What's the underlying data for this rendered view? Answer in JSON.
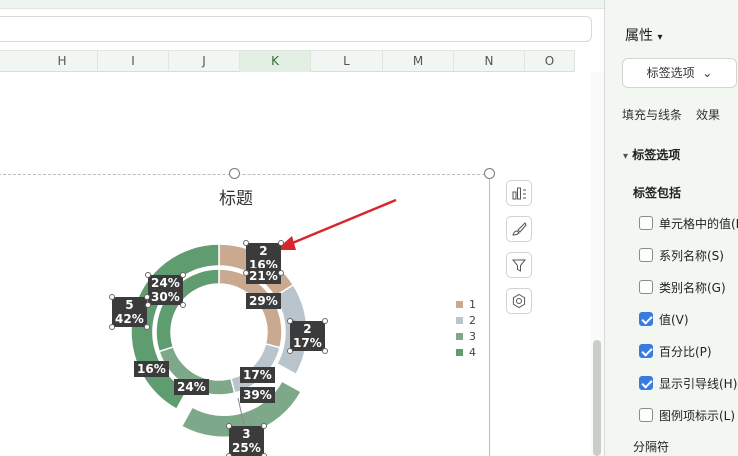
{
  "sheet": {
    "columns": [
      "H",
      "I",
      "J",
      "K",
      "L",
      "M",
      "N",
      "O"
    ],
    "selected_columns": [
      "K"
    ]
  },
  "chart": {
    "title": "标题"
  },
  "chart_data": {
    "type": "pie",
    "subtype": "doughnut",
    "title": "标题",
    "legend_position": "right",
    "series": [
      {
        "name": "1",
        "color": "#c9a990"
      },
      {
        "name": "2",
        "color": "#b9c4cc"
      },
      {
        "name": "3",
        "color": "#7ea88a"
      },
      {
        "name": "4",
        "color": "#5f9c70"
      }
    ],
    "rings": [
      {
        "ring": "inner",
        "slices": [
          {
            "series": "1",
            "percent": 29
          },
          {
            "series": "2",
            "percent": 17
          },
          {
            "series": "3",
            "percent": 24
          },
          {
            "series": "4",
            "percent": 30
          }
        ]
      },
      {
        "ring": "outer",
        "slices": [
          {
            "series": "1",
            "percent": 16
          },
          {
            "series": "2",
            "percent": 17
          },
          {
            "series": "3",
            "percent": 25
          },
          {
            "series": "4",
            "percent": 42
          }
        ]
      }
    ],
    "data_labels": [
      {
        "value": "2",
        "percent": "16%"
      },
      {
        "value": "",
        "percent": "21%"
      },
      {
        "value": "",
        "percent": "29%"
      },
      {
        "value": "2",
        "percent": "17%"
      },
      {
        "value": "",
        "percent": "17%"
      },
      {
        "value": "",
        "percent": "39%"
      },
      {
        "value": "3",
        "percent": "25%"
      },
      {
        "value": "",
        "percent": "24%"
      },
      {
        "value": "",
        "percent": "16%"
      },
      {
        "value": "5",
        "percent": "42%"
      },
      {
        "value": "24%",
        "percent": "30%"
      }
    ]
  },
  "legend": {
    "items": [
      {
        "label": "1",
        "color": "#c9a990"
      },
      {
        "label": "2",
        "color": "#b9c4cc"
      },
      {
        "label": "3",
        "color": "#7ea88a"
      },
      {
        "label": "4",
        "color": "#5f9c70"
      }
    ]
  },
  "tools": [
    "chart-elements-icon",
    "chart-style-icon",
    "chart-filter-icon",
    "chart-settings-icon"
  ],
  "panel": {
    "title": "属性",
    "title_caret": "▾",
    "dropdown": "标签选项",
    "dropdown_caret": "⌄",
    "tabs": [
      "填充与线条",
      "效果"
    ],
    "section": "标签选项",
    "section_caret": "▾",
    "sub": "标签包括",
    "options": [
      {
        "label": "单元格中的值(F",
        "checked": false
      },
      {
        "label": "系列名称(S)",
        "checked": false
      },
      {
        "label": "类别名称(G)",
        "checked": false
      },
      {
        "label": "值(V)",
        "checked": true
      },
      {
        "label": "百分比(P)",
        "checked": true
      },
      {
        "label": "显示引导线(H)",
        "checked": true
      },
      {
        "label": "图例项标示(L)",
        "checked": false
      }
    ],
    "separator_label": "分隔符"
  },
  "colors": {
    "accent": "#3a7be0",
    "annotation_arrow": "#d9262c",
    "label_bg": "#3b3b3b"
  }
}
